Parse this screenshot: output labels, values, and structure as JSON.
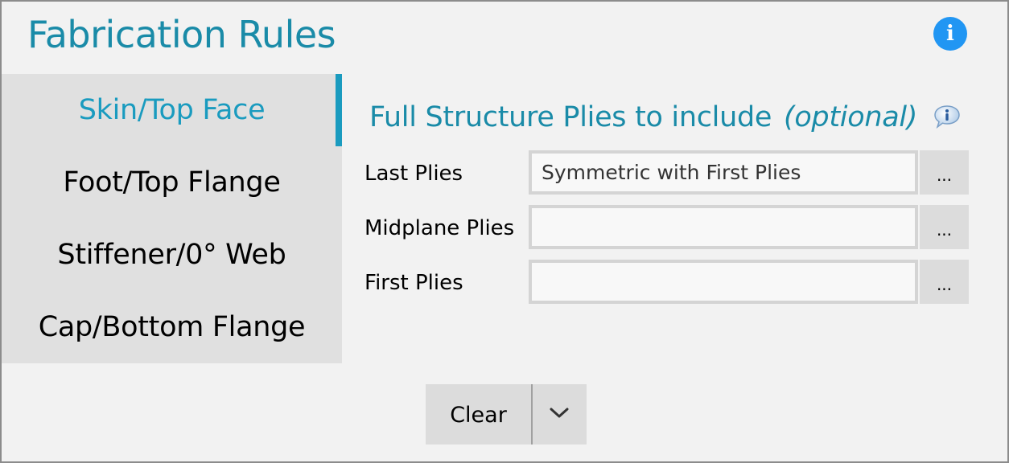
{
  "header": {
    "title": "Fabrication Rules",
    "info_icon": "info-circle-icon"
  },
  "sidebar": {
    "active_index": 0,
    "items": [
      {
        "label": "Skin/Top Face"
      },
      {
        "label": "Foot/Top Flange"
      },
      {
        "label": "Stiffener/0° Web"
      },
      {
        "label": "Cap/Bottom Flange"
      }
    ]
  },
  "main": {
    "section_title": "Full Structure Plies to include",
    "section_title_optional": "(optional)",
    "section_info_icon": "info-bubble-icon",
    "fields": [
      {
        "label": "Last Plies",
        "value": "Symmetric with First Plies",
        "button_label": "..."
      },
      {
        "label": "Midplane Plies",
        "value": "",
        "button_label": "..."
      },
      {
        "label": "First Plies",
        "value": "",
        "button_label": "..."
      }
    ]
  },
  "footer": {
    "clear_label": "Clear",
    "dropdown_icon": "chevron-down-icon"
  },
  "colors": {
    "accent": "#1a9bbf",
    "title": "#1a8ba8",
    "info_blue": "#2196f3",
    "panel_gray": "#e0e0e0",
    "window_bg": "#f2f2f2"
  }
}
